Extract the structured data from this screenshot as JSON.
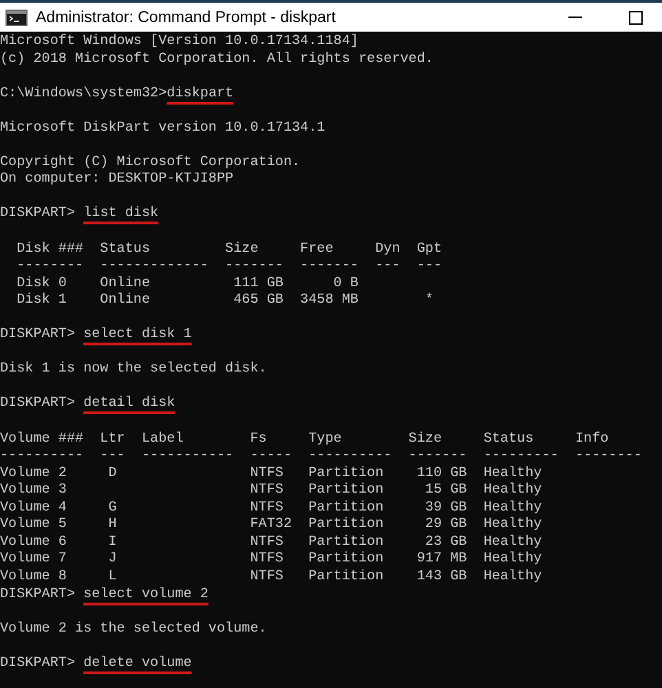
{
  "window": {
    "title": "Administrator: Command Prompt - diskpart"
  },
  "console": {
    "lines": [
      {
        "kind": "output",
        "text": "Microsoft Windows [Version 10.0.17134.1184]"
      },
      {
        "kind": "output",
        "text": "(c) 2018 Microsoft Corporation. All rights reserved."
      },
      {
        "kind": "blank"
      },
      {
        "kind": "command",
        "prompt": "C:\\Windows\\system32>",
        "command": "diskpart",
        "underlined": true
      },
      {
        "kind": "blank"
      },
      {
        "kind": "output",
        "text": "Microsoft DiskPart version 10.0.17134.1"
      },
      {
        "kind": "blank"
      },
      {
        "kind": "output",
        "text": "Copyright (C) Microsoft Corporation."
      },
      {
        "kind": "output",
        "text": "On computer: DESKTOP-KTJI8PP"
      },
      {
        "kind": "blank"
      },
      {
        "kind": "command",
        "prompt": "DISKPART> ",
        "command": "list disk",
        "underlined": true
      },
      {
        "kind": "blank"
      },
      {
        "kind": "output",
        "text": "  Disk ###  Status         Size     Free     Dyn  Gpt"
      },
      {
        "kind": "output",
        "text": "  --------  -------------  -------  -------  ---  ---"
      },
      {
        "kind": "output",
        "text": "  Disk 0    Online          111 GB      0 B"
      },
      {
        "kind": "output",
        "text": "  Disk 1    Online          465 GB  3458 MB        *"
      },
      {
        "kind": "blank"
      },
      {
        "kind": "command",
        "prompt": "DISKPART> ",
        "command": "select disk 1",
        "underlined": true
      },
      {
        "kind": "blank"
      },
      {
        "kind": "output",
        "text": "Disk 1 is now the selected disk."
      },
      {
        "kind": "blank"
      },
      {
        "kind": "command",
        "prompt": "DISKPART> ",
        "command": "detail disk",
        "underlined": true
      },
      {
        "kind": "blank"
      },
      {
        "kind": "output",
        "text": "Volume ###  Ltr  Label        Fs     Type        Size     Status     Info"
      },
      {
        "kind": "output",
        "text": "----------  ---  -----------  -----  ----------  -------  ---------  --------"
      },
      {
        "kind": "output",
        "text": "Volume 2     D                NTFS   Partition    110 GB  Healthy"
      },
      {
        "kind": "output",
        "text": "Volume 3                      NTFS   Partition     15 GB  Healthy"
      },
      {
        "kind": "output",
        "text": "Volume 4     G                NTFS   Partition     39 GB  Healthy"
      },
      {
        "kind": "output",
        "text": "Volume 5     H                FAT32  Partition     29 GB  Healthy"
      },
      {
        "kind": "output",
        "text": "Volume 6     I                NTFS   Partition     23 GB  Healthy"
      },
      {
        "kind": "output",
        "text": "Volume 7     J                NTFS   Partition    917 MB  Healthy"
      },
      {
        "kind": "output",
        "text": "Volume 8     L                NTFS   Partition    143 GB  Healthy"
      },
      {
        "kind": "command",
        "prompt": "DISKPART> ",
        "command": "select volume 2",
        "underlined": true
      },
      {
        "kind": "blank"
      },
      {
        "kind": "output",
        "text": "Volume 2 is the selected volume."
      },
      {
        "kind": "blank"
      },
      {
        "kind": "command",
        "prompt": "DISKPART> ",
        "command": "delete volume",
        "underlined": true
      }
    ]
  }
}
